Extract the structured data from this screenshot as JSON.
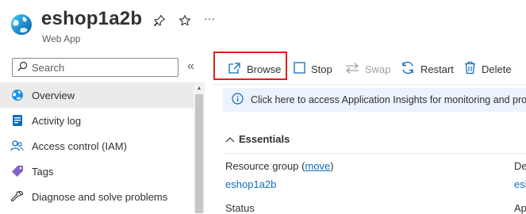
{
  "header": {
    "title": "eshop1a2b",
    "subtitle": "Web App",
    "more_label": "···"
  },
  "sidebar": {
    "search_placeholder": "Search",
    "collapse_label": "«",
    "items": [
      {
        "label": "Overview",
        "icon": "globe-icon",
        "active": true
      },
      {
        "label": "Activity log",
        "icon": "activity-log-icon"
      },
      {
        "label": "Access control (IAM)",
        "icon": "people-icon"
      },
      {
        "label": "Tags",
        "icon": "tag-icon"
      },
      {
        "label": "Diagnose and solve problems",
        "icon": "wrench-icon"
      }
    ]
  },
  "toolbar": {
    "browse": "Browse",
    "stop": "Stop",
    "swap": "Swap",
    "restart": "Restart",
    "delete": "Delete"
  },
  "banner": {
    "text": "Click here to access Application Insights for monitoring and profil"
  },
  "essentials": {
    "label": "Essentials",
    "resource_group_label": "Resource group (",
    "move_link": "move",
    "resource_group_close": ")",
    "resource_group_value": "eshop1a2b",
    "status_label": "Status",
    "right_col_label_partial": "De",
    "right_col_value_partial": "esh",
    "right_col_label2_partial": "Ap"
  },
  "colors": {
    "accent": "#0f6cbd",
    "highlight_border": "#e01e1e",
    "banner_bg": "#ebf3fc",
    "active_nav_bg": "#edebe9"
  }
}
